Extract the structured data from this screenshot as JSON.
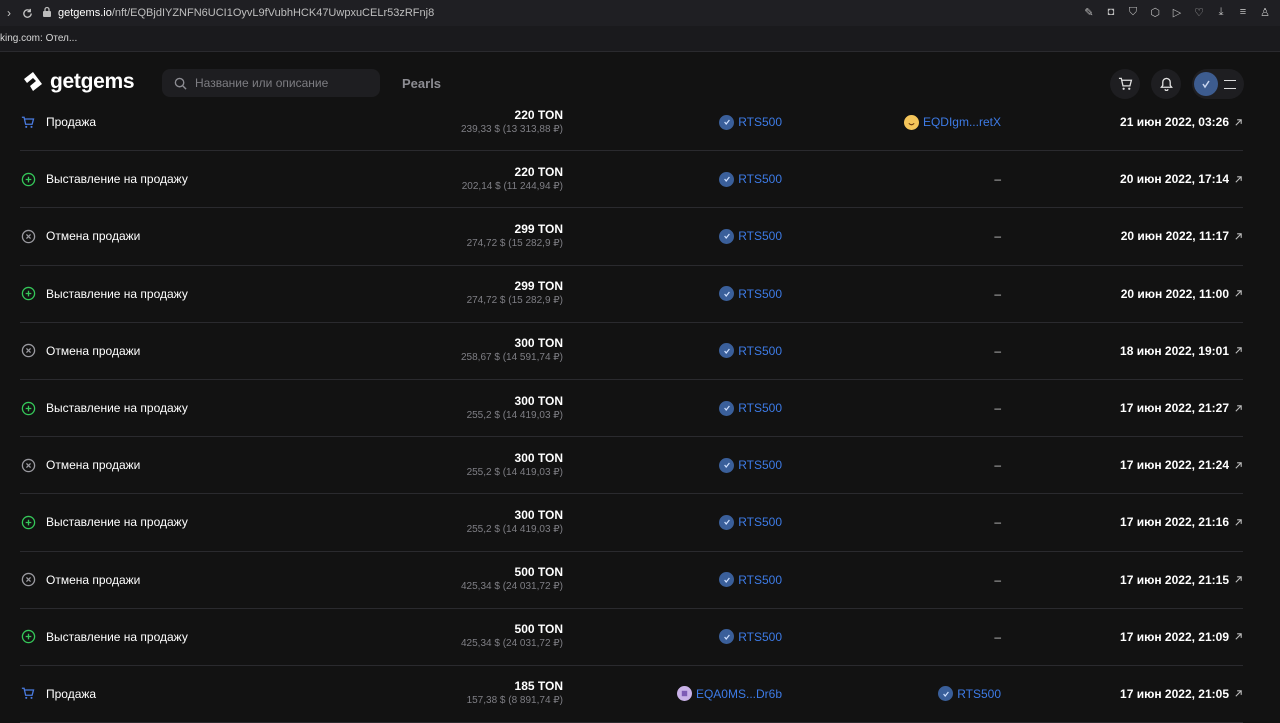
{
  "browser": {
    "url_host": "getgems.io",
    "url_path": "/nft/EQBjdIYZNFN6UCI1OyvL9fVubhHCK47UwpxuCELr53zRFnj8",
    "bookmark": "king.com: Отел..."
  },
  "header": {
    "logo_text": "getgems",
    "search_placeholder": "Название или описание",
    "nav_link": "Pearls"
  },
  "colors": {
    "accent_blue": "#3d7be6",
    "listing_green": "#35c759",
    "sale_blue": "#3d7be6",
    "cancel_gray": "#9a9aa0"
  },
  "rows": [
    {
      "type": "sale",
      "label": "Продажа",
      "icon": "cart-icon",
      "ton": "220 TON",
      "fiat": "239,33 $ (13 313,88 ₽)",
      "from": "RTS500",
      "from_icon": "verified-avatar",
      "to": "EQDIgm...retX",
      "to_icon": "emoji-avatar",
      "date": "21 июн 2022, 03:26"
    },
    {
      "type": "listing",
      "label": "Выставление на продажу",
      "icon": "plus-circle-icon",
      "ton": "220 TON",
      "fiat": "202,14 $ (11 244,94 ₽)",
      "from": "RTS500",
      "from_icon": "verified-avatar",
      "to": "–",
      "date": "20 июн 2022, 17:14"
    },
    {
      "type": "cancel",
      "label": "Отмена продажи",
      "icon": "x-circle-icon",
      "ton": "299 TON",
      "fiat": "274,72 $ (15 282,9 ₽)",
      "from": "RTS500",
      "from_icon": "verified-avatar",
      "to": "–",
      "date": "20 июн 2022, 11:17"
    },
    {
      "type": "listing",
      "label": "Выставление на продажу",
      "icon": "plus-circle-icon",
      "ton": "299 TON",
      "fiat": "274,72 $ (15 282,9 ₽)",
      "from": "RTS500",
      "from_icon": "verified-avatar",
      "to": "–",
      "date": "20 июн 2022, 11:00"
    },
    {
      "type": "cancel",
      "label": "Отмена продажи",
      "icon": "x-circle-icon",
      "ton": "300 TON",
      "fiat": "258,67 $ (14 591,74 ₽)",
      "from": "RTS500",
      "from_icon": "verified-avatar",
      "to": "–",
      "date": "18 июн 2022, 19:01"
    },
    {
      "type": "listing",
      "label": "Выставление на продажу",
      "icon": "plus-circle-icon",
      "ton": "300 TON",
      "fiat": "255,2 $ (14 419,03 ₽)",
      "from": "RTS500",
      "from_icon": "verified-avatar",
      "to": "–",
      "date": "17 июн 2022, 21:27"
    },
    {
      "type": "cancel",
      "label": "Отмена продажи",
      "icon": "x-circle-icon",
      "ton": "300 TON",
      "fiat": "255,2 $ (14 419,03 ₽)",
      "from": "RTS500",
      "from_icon": "verified-avatar",
      "to": "–",
      "date": "17 июн 2022, 21:24"
    },
    {
      "type": "listing",
      "label": "Выставление на продажу",
      "icon": "plus-circle-icon",
      "ton": "300 TON",
      "fiat": "255,2 $ (14 419,03 ₽)",
      "from": "RTS500",
      "from_icon": "verified-avatar",
      "to": "–",
      "date": "17 июн 2022, 21:16"
    },
    {
      "type": "cancel",
      "label": "Отмена продажи",
      "icon": "x-circle-icon",
      "ton": "500 TON",
      "fiat": "425,34 $ (24 031,72 ₽)",
      "from": "RTS500",
      "from_icon": "verified-avatar",
      "to": "–",
      "date": "17 июн 2022, 21:15"
    },
    {
      "type": "listing",
      "label": "Выставление на продажу",
      "icon": "plus-circle-icon",
      "ton": "500 TON",
      "fiat": "425,34 $ (24 031,72 ₽)",
      "from": "RTS500",
      "from_icon": "verified-avatar",
      "to": "–",
      "date": "17 июн 2022, 21:09"
    },
    {
      "type": "sale",
      "label": "Продажа",
      "icon": "cart-icon",
      "ton": "185 TON",
      "fiat": "157,38 $ (8 891,74 ₽)",
      "from": "EQA0MS...Dr6b",
      "from_icon": "pixel-avatar",
      "to": "RTS500",
      "to_icon": "verified-avatar",
      "date": "17 июн 2022, 21:05"
    }
  ]
}
